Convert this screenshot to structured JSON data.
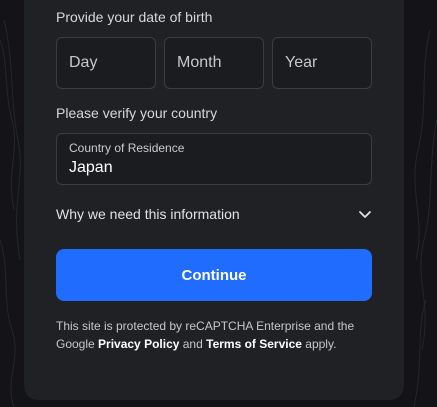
{
  "dob": {
    "label": "Provide your date of birth",
    "day_placeholder": "Day",
    "month_placeholder": "Month",
    "year_placeholder": "Year"
  },
  "country": {
    "label": "Please verify your country",
    "field_label": "Country of Residence",
    "value": "Japan"
  },
  "info": {
    "label": "Why we need this information",
    "icon": "chevron-down-icon"
  },
  "continue_label": "Continue",
  "legal": {
    "prefix": "This site is protected by reCAPTCHA Enterprise and the Google ",
    "privacy": "Privacy Policy",
    "and": " and ",
    "terms": "Terms of Service",
    "suffix": " apply."
  },
  "colors": {
    "accent": "#1f6cff",
    "card": "#1f2125",
    "background": "#141418"
  }
}
